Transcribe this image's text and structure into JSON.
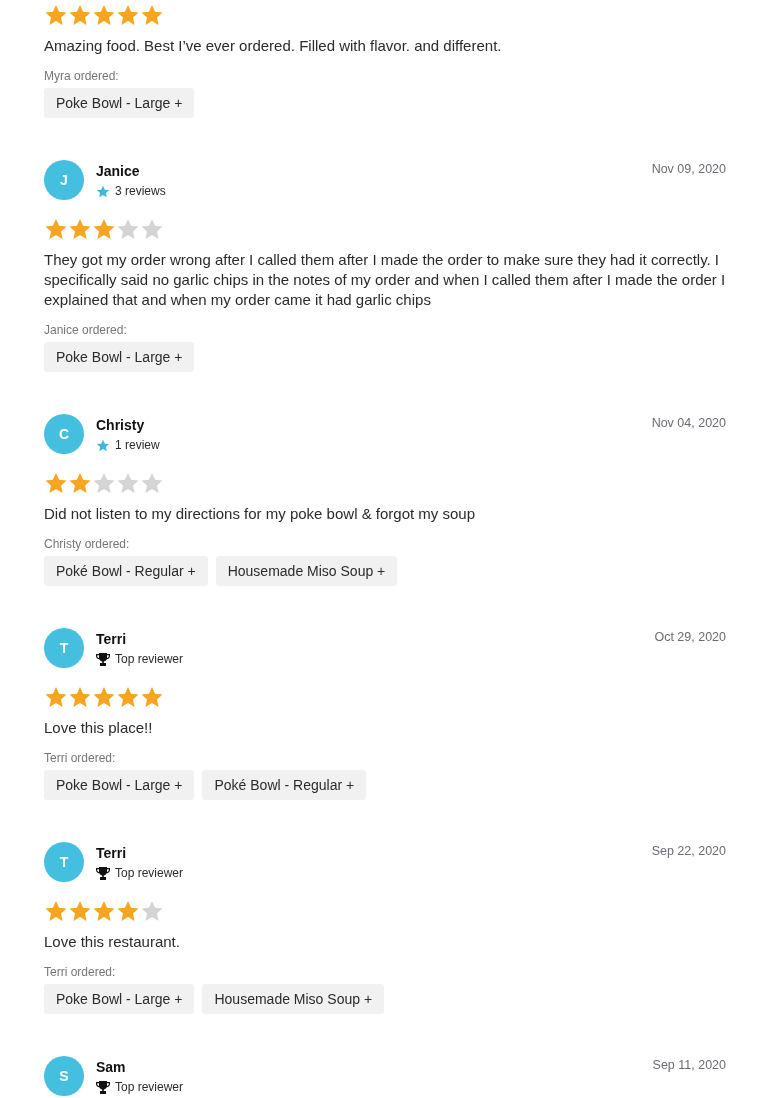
{
  "reviews": [
    {
      "stars": 5,
      "text": "Amazing food. Best I’ve ever ordered. Filled with flavor. and different.",
      "ordered_label": "Myra ordered:",
      "items": [
        "Poke Bowl - Large +"
      ]
    },
    {
      "reviewer": {
        "initial": "J",
        "name": "Janice",
        "badge": {
          "kind": "reviews",
          "label": "3 reviews"
        }
      },
      "date": "Nov 09, 2020",
      "stars": 3,
      "text": "They got my order wrong after I called them after I made the order to make sure they had it correctly. I specifically said no garlic chips in the notes of my order and when I called them after I made the order I explained that and when my order came it had garlic chips",
      "ordered_label": "Janice ordered:",
      "items": [
        "Poke Bowl - Large +"
      ]
    },
    {
      "reviewer": {
        "initial": "C",
        "name": "Christy",
        "badge": {
          "kind": "reviews",
          "label": "1 review"
        }
      },
      "date": "Nov 04, 2020",
      "stars": 2,
      "text": "Did not listen to my directions for my poke bowl & forgot my soup",
      "ordered_label": "Christy ordered:",
      "items": [
        "Poké Bowl - Regular +",
        "Housemade Miso Soup +"
      ]
    },
    {
      "reviewer": {
        "initial": "T",
        "name": "Terri",
        "badge": {
          "kind": "top",
          "label": "Top reviewer"
        }
      },
      "date": "Oct 29, 2020",
      "stars": 5,
      "text": "Love this place!!",
      "ordered_label": "Terri ordered:",
      "items": [
        "Poke Bowl - Large +",
        "Poké Bowl - Regular +"
      ]
    },
    {
      "reviewer": {
        "initial": "T",
        "name": "Terri",
        "badge": {
          "kind": "top",
          "label": "Top reviewer"
        }
      },
      "date": "Sep 22, 2020",
      "stars": 4,
      "text": "Love this restaurant.",
      "ordered_label": "Terri ordered:",
      "items": [
        "Poke Bowl - Large +",
        "Housemade Miso Soup +"
      ]
    },
    {
      "reviewer": {
        "initial": "S",
        "name": "Sam",
        "badge": {
          "kind": "top",
          "label": "Top reviewer"
        }
      },
      "date": "Sep 11, 2020"
    }
  ]
}
